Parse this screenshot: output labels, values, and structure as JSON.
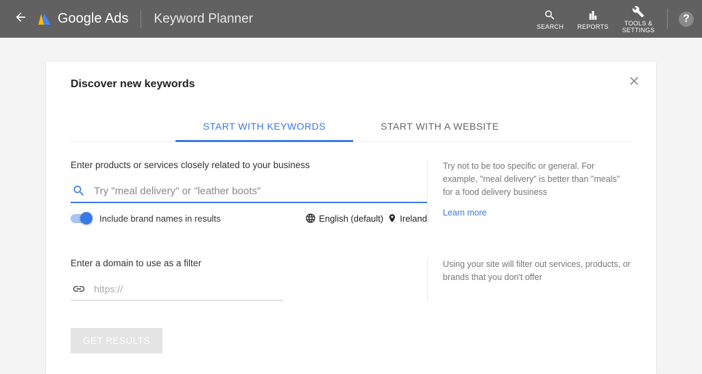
{
  "header": {
    "brand": "Google Ads",
    "page": "Keyword Planner",
    "tools": {
      "search": "SEARCH",
      "reports": "REPORTS",
      "settings_l1": "TOOLS &",
      "settings_l2": "SETTINGS"
    }
  },
  "card": {
    "title": "Discover new keywords",
    "tabs": {
      "keywords": "START WITH KEYWORDS",
      "website": "START WITH A WEBSITE"
    },
    "field1": {
      "label": "Enter products or services closely related to your business",
      "placeholder": "Try \"meal delivery\" or \"leather boots\""
    },
    "toggle": {
      "label": "Include brand names in results"
    },
    "lang": "English (default)",
    "loc": "Ireland",
    "tip1": "Try not to be too specific or general. For example, \"meal delivery\" is better than \"meals\" for a food delivery business",
    "learn": "Learn more",
    "field2": {
      "label": "Enter a domain to use as a filter",
      "placeholder": "https://"
    },
    "tip2": "Using your site will filter out services, products, or brands that you don't offer",
    "button": "GET RESULTS"
  }
}
